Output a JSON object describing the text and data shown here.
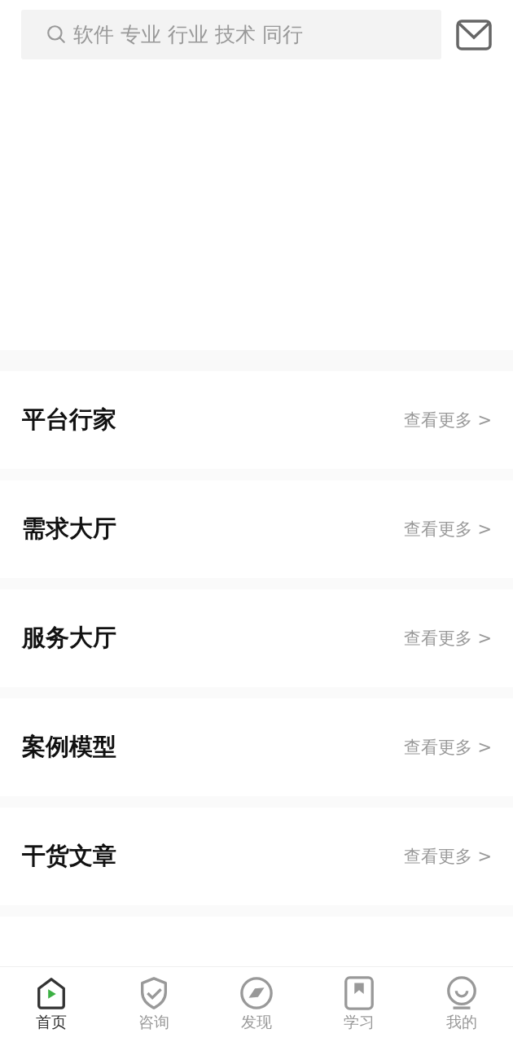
{
  "search": {
    "placeholder": "软件 专业 行业 技术 同行"
  },
  "sections": [
    {
      "title": "平台行家",
      "more": "查看更多 >"
    },
    {
      "title": "需求大厅",
      "more": "查看更多 >"
    },
    {
      "title": "服务大厅",
      "more": "查看更多 >"
    },
    {
      "title": "案例模型",
      "more": "查看更多 >"
    },
    {
      "title": "干货文章",
      "more": "查看更多 >"
    }
  ],
  "tab_bar": [
    {
      "kind": "home",
      "label": "首页",
      "selected": true
    },
    {
      "kind": "consult",
      "label": "咨询",
      "selected": false
    },
    {
      "kind": "discover",
      "label": "发现",
      "selected": false
    },
    {
      "kind": "learn",
      "label": "学习",
      "selected": false
    },
    {
      "kind": "me",
      "label": "我的",
      "selected": false
    }
  ]
}
